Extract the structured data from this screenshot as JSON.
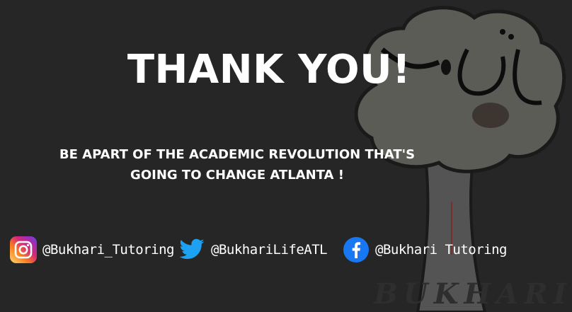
{
  "slide": {
    "title": "THANK YOU!",
    "subtitle_line1": "BE APART OF THE ACADEMIC REVOLUTION THAT'S",
    "subtitle_line2": "GOING TO CHANGE ATLANTA !",
    "logo_wordmark": "BUKHARI"
  },
  "socials": [
    {
      "platform": "instagram",
      "icon": "instagram-icon",
      "handle": "@Bukhari_Tutoring"
    },
    {
      "platform": "twitter",
      "icon": "twitter-icon",
      "handle": "@BukhariLifeATL"
    },
    {
      "platform": "facebook",
      "icon": "facebook-icon",
      "handle": "@Bukhari Tutoring"
    }
  ],
  "colors": {
    "background": "#262626",
    "text": "#ffffff",
    "twitter": "#1DA1F2",
    "facebook": "#1877F2"
  }
}
